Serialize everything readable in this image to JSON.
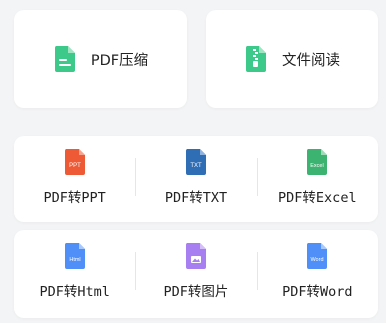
{
  "top_cards": [
    {
      "label": "PDF压缩",
      "icon": "pdf-compress-icon",
      "color": "#3cc98a"
    },
    {
      "label": "文件阅读",
      "icon": "file-read-icon",
      "color": "#3cc98a"
    }
  ],
  "convert_rows": [
    [
      {
        "label": "PDF转PPT",
        "icon_text": "PPT",
        "color": "#ef5a36"
      },
      {
        "label": "PDF转TXT",
        "icon_text": "TXT",
        "color": "#2f6db5"
      },
      {
        "label": "PDF转Excel",
        "icon_text": "Excel",
        "color": "#3cb371"
      }
    ],
    [
      {
        "label": "PDF转Html",
        "icon_text": "Html",
        "color": "#4f8ff7"
      },
      {
        "label": "PDF转图片",
        "icon_text": "",
        "color": "#a87ff0"
      },
      {
        "label": "PDF转Word",
        "icon_text": "Word",
        "color": "#4f8ff7"
      }
    ]
  ]
}
